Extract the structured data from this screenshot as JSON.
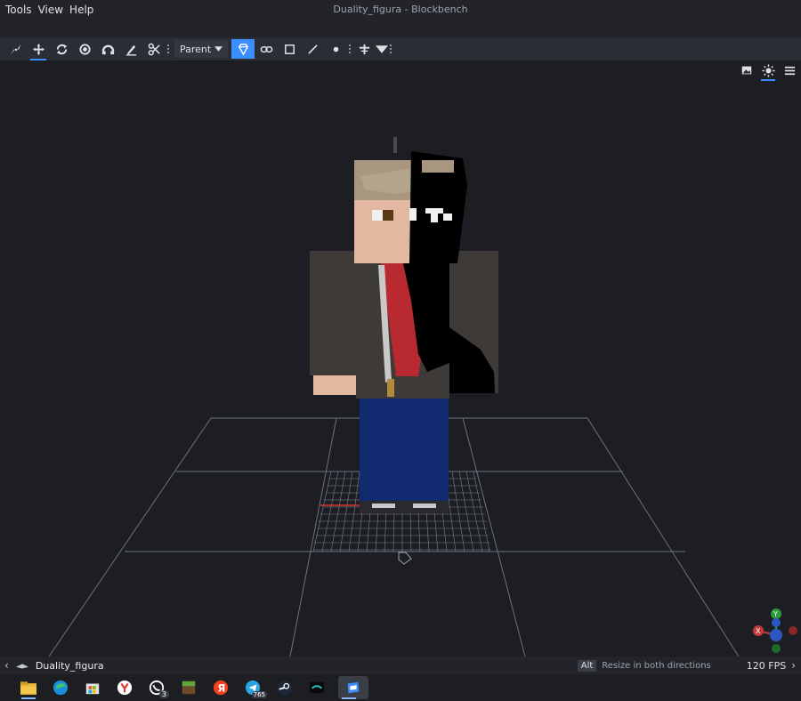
{
  "menu": {
    "tools": "Tools",
    "view": "View",
    "help": "Help"
  },
  "window": {
    "title": "Duality_figura - Blockbench"
  },
  "toolbar": {
    "tools": [
      "move-tool",
      "transform-tool",
      "rotate-tool",
      "pivot-tool",
      "vertex-snap-tool",
      "paint-tool",
      "knife-tool"
    ],
    "pivot_mode": "Parent",
    "pivot_mode_selected": true
  },
  "statusbar": {
    "project_name": "Duality_figura",
    "key": "Alt",
    "hint": "Resize in both directions",
    "fps": "120 FPS"
  },
  "taskbar": {
    "apps": [
      "file-explorer",
      "edge",
      "microsoft-store",
      "yandex-browser",
      "whatsapp",
      "minecraft",
      "yandex",
      "telegram",
      "steam",
      "ubisoft",
      "blockbench"
    ],
    "whatsapp_badge": "3",
    "telegram_badge": "765"
  },
  "colors": {
    "accent": "#3c8dff",
    "background": "#1d1e23",
    "grid": "#8a8f99"
  }
}
